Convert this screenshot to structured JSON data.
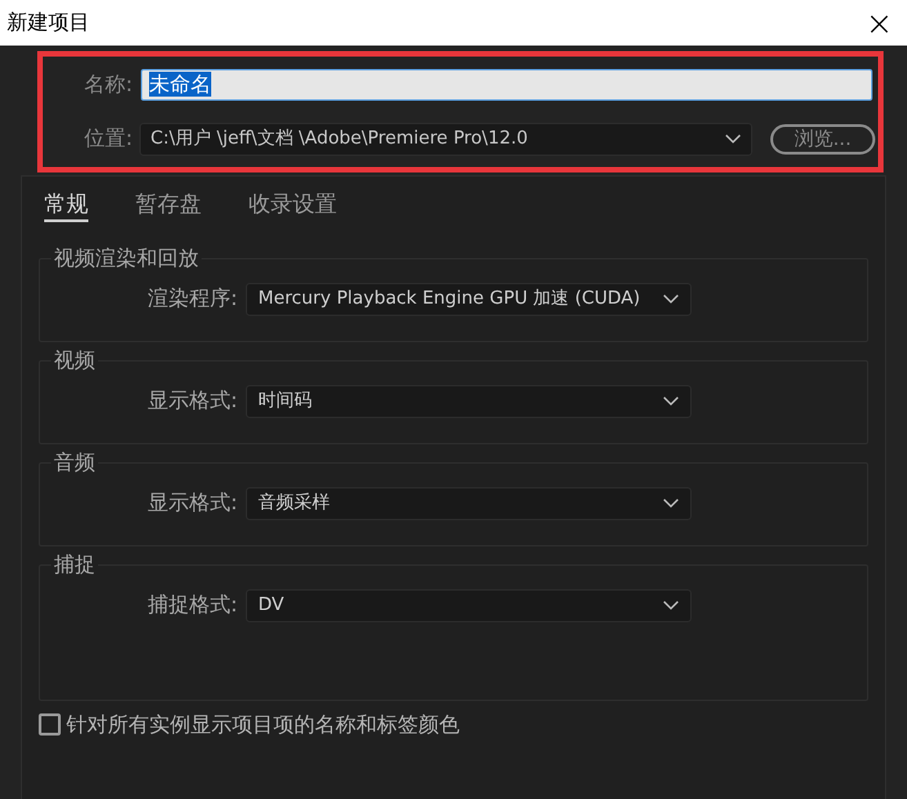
{
  "window": {
    "title": "新建项目",
    "close": "×"
  },
  "name_field": {
    "label": "名称:",
    "value": "未命名",
    "text_selected": true
  },
  "location_field": {
    "label": "位置:",
    "value": "C:\\用户 \\jeff\\文档 \\Adobe\\Premiere Pro\\12.0"
  },
  "browse_button": "浏览...",
  "tabs": [
    {
      "label": "常规",
      "selected": true
    },
    {
      "label": "暂存盘",
      "selected": false
    },
    {
      "label": "收录设置",
      "selected": false
    }
  ],
  "groups": [
    {
      "title": "视频渲染和回放",
      "label": "渲染程序:",
      "value": "Mercury Playback Engine GPU 加速 (CUDA)",
      "tall": false
    },
    {
      "title": "视频",
      "label": "显示格式:",
      "value": "时间码",
      "tall": false
    },
    {
      "title": "音频",
      "label": "显示格式:",
      "value": "音频采样",
      "tall": false
    },
    {
      "title": "捕捉",
      "label": "捕捉格式:",
      "value": "DV",
      "tall": true
    }
  ],
  "checkbox": {
    "label": "针对所有实例显示项目项的名称和标签颜色",
    "checked": false
  }
}
